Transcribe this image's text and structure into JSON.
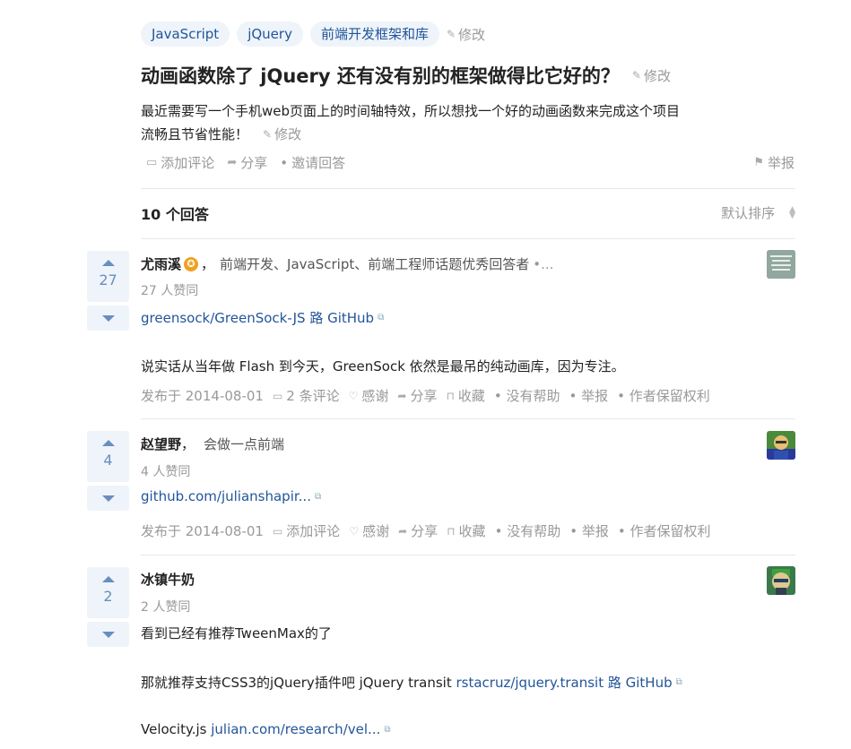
{
  "tags": [
    "JavaScript",
    "jQuery",
    "前端开发框架和库"
  ],
  "edit_label": "修改",
  "question": {
    "title": "动画函数除了 jQuery 还有没有别的框架做得比它好的？",
    "detail_line1": "最近需要写一个手机web页面上的时间轴特效，所以想找一个好的动画函数来完成这个项目",
    "detail_line2": "流畅且节省性能！",
    "actions": {
      "comment": "添加评论",
      "share": "分享",
      "invite": "邀请回答",
      "report": "举报"
    }
  },
  "answers_header": {
    "count": "10 个回答",
    "sort": "默认排序"
  },
  "answers": [
    {
      "votes": "27",
      "author": "尤雨溪",
      "bio": "前端开发、JavaScript、前端工程师话题优秀回答者",
      "more": "•...",
      "vote_text": "27 人赞同",
      "link": "greensock/GreenSock-JS 路 GitHub",
      "body": "说实话从当年做 Flash 到今天，GreenSock 依然是最吊的纯动画库，因为专注。",
      "meta": {
        "date": "发布于 2014-08-01",
        "comments": "2 条评论",
        "thanks": "感谢",
        "share": "分享",
        "collect": "收藏",
        "no_help": "没有帮助",
        "report": "举报",
        "copyright": "作者保留权利"
      }
    },
    {
      "votes": "4",
      "author": "赵望野",
      "bio": "会做一点前端",
      "vote_text": "4 人赞同",
      "link": "github.com/julianshapir...",
      "meta": {
        "date": "发布于 2014-08-01",
        "comments": "添加评论",
        "thanks": "感谢",
        "share": "分享",
        "collect": "收藏",
        "no_help": "没有帮助",
        "report": "举报",
        "copyright": "作者保留权利"
      }
    },
    {
      "votes": "2",
      "author": "冰镇牛奶",
      "vote_text": "2 人赞同",
      "line1": "看到已经有推荐TweenMax的了",
      "line2_text": "那就推荐支持CSS3的jQuery插件吧 jQuery transit ",
      "line2_link": "rstacruz/jquery.transit 路 GitHub",
      "line3_text": "Velocity.js ",
      "line3_link": "julian.com/research/vel..."
    }
  ],
  "colors": {
    "link": "#225599",
    "vote": "#698ebf",
    "tag_bg": "#eef4fa",
    "badge": "#f0a020"
  }
}
